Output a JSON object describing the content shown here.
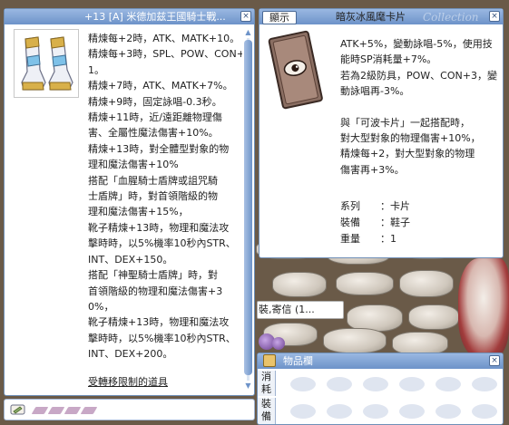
{
  "item_window": {
    "title": "+13 [A] 米德加兹王國騎士戰...",
    "close": "×",
    "description_lines": [
      "精煉每+2時，ATK、MATK+10。",
      "精煉每+3時，SPL、POW、CON+",
      "1。",
      "精煉+7時，ATK、MATK+7%。",
      "精煉+9時，固定詠唱-0.3秒。",
      "精煉+11時，近/遠距離物理傷",
      "害、全屬性魔法傷害+10%。",
      "精煉+13時，對全體型對象的物",
      "理和魔法傷害+10%",
      "搭配「血腥騎士盾牌或詛咒騎",
      "士盾牌」時，對首領階級的物",
      "理和魔法傷害+15%，",
      "靴子精煉+13時，物理和魔法攻",
      "擊時時，以5%機率10秒內STR、",
      "INT、DEX+150。",
      "搭配「神聖騎士盾牌」時，對",
      "首領階級的物理和魔法傷害+3",
      "0%，",
      "靴子精煉+13時，物理和魔法攻",
      "擊時時，以5%機率10秒內STR、",
      "INT、DEX+200。"
    ],
    "restricted_label": "受轉移限制的道具"
  },
  "card_window": {
    "display_button": "顯示",
    "title": "暗灰冰風麾卡片",
    "watermark": "Collection",
    "close": "×",
    "description_lines": [
      "ATK+5%，變動詠唱-5%，使用技",
      "能時SP消耗量+7%。",
      "若為2級防具，POW、CON+3，變",
      "動詠唱再-3%。"
    ],
    "combo_lines": [
      "與「可波卡片」一起搭配時，",
      "對大型對象的物理傷害+10%，",
      "精煉每+2，對大型對象的物理",
      "傷害再+3%。"
    ],
    "properties": [
      {
        "key": "系列",
        "sep": "：",
        "value": "卡片"
      },
      {
        "key": "裝備",
        "sep": "：",
        "value": "鞋子"
      },
      {
        "key": "重量",
        "sep": "：",
        "value": "1"
      }
    ]
  },
  "message_strip": {
    "text": "裝,寄信 (1..."
  },
  "inventory": {
    "title": "物品欄",
    "close": "×",
    "tabs": [
      "消耗",
      "裝備"
    ]
  },
  "colors": {
    "titlebar": "#6d93c9",
    "window_border": "#6f8fb7"
  }
}
